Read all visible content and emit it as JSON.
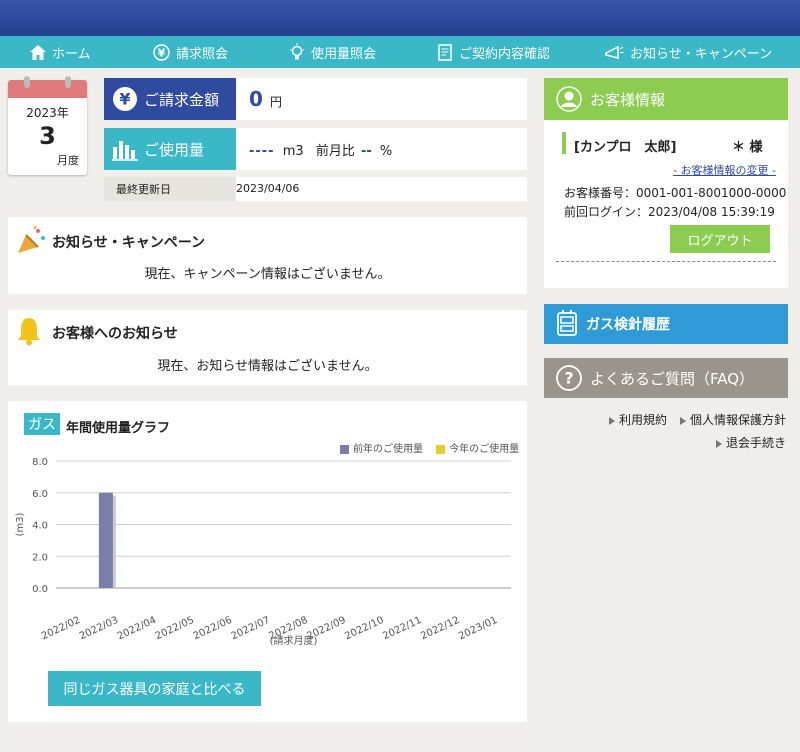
{
  "nav": {
    "home": "ホーム",
    "billing": "請求照会",
    "usage": "使用量照会",
    "contract": "ご契約内容確認",
    "news": "お知らせ・キャンペーン"
  },
  "calendar": {
    "year": "2023年",
    "month": "3",
    "unit": "月度"
  },
  "billing": {
    "amount_label": "ご請求金額",
    "amount_value": "0",
    "amount_unit": "円",
    "usage_label": "ご使用量",
    "usage_value": "----",
    "usage_unit": "m3",
    "prev_ratio_label": "前月比",
    "prev_ratio_value": "--",
    "prev_ratio_unit": "%",
    "updated_label": "最終更新日",
    "updated_value": "2023/04/06"
  },
  "campaign": {
    "title": "お知らせ・キャンペーン",
    "message": "現在、キャンペーン情報はございません。"
  },
  "notice": {
    "title": "お客様へのお知らせ",
    "message": "現在、お知らせ情報はございません。"
  },
  "customer": {
    "header": "お客様情報",
    "name": "[カンプロ　太郎]",
    "honorific": "＊ 様",
    "change_link": "- お客様情報の変更 -",
    "number_label": "お客様番号：",
    "number_value": "0001-001-8001000-0000",
    "last_login_label": "前回ログイン：",
    "last_login_value": "2023/04/08 15:39:19",
    "logout": "ログアウト"
  },
  "sidebar": {
    "history": "ガス検針履歴",
    "faq": "よくあるご質問（FAQ）",
    "terms": "利用規約",
    "privacy": "個人情報保護方針",
    "withdraw": "退会手続き"
  },
  "chart_section": {
    "badge": "ガス",
    "title": "年間使用量グラフ",
    "compare_button": "同じガス器具の家庭と比べる"
  },
  "colors": {
    "accent_cyan": "#3ab8c8",
    "brand_blue": "#2f4a9e",
    "green": "#8ccc50",
    "bar_prev": "#7a7ea6",
    "bar_curr": "#e3cf2a"
  },
  "chart_data": {
    "type": "bar",
    "categories": [
      "2022/02",
      "2022/03",
      "2022/04",
      "2022/05",
      "2022/06",
      "2022/07",
      "2022/08",
      "2022/09",
      "2022/10",
      "2022/11",
      "2022/12",
      "2023/01"
    ],
    "series": [
      {
        "name": "前年のご使用量",
        "values": [
          0,
          6,
          0,
          0,
          0,
          0,
          0,
          0,
          0,
          0,
          0,
          0
        ]
      },
      {
        "name": "今年のご使用量",
        "values": [
          0,
          0,
          0,
          0,
          0,
          0,
          0,
          0,
          0,
          0,
          0,
          0
        ]
      }
    ],
    "ylabel": "(m3)",
    "xlabel": "(請求月度)",
    "ylim": [
      0,
      8
    ],
    "yticks": [
      "0.0",
      "2.0",
      "4.0",
      "6.0",
      "8.0"
    ],
    "grid": true,
    "legend": "top-right"
  }
}
